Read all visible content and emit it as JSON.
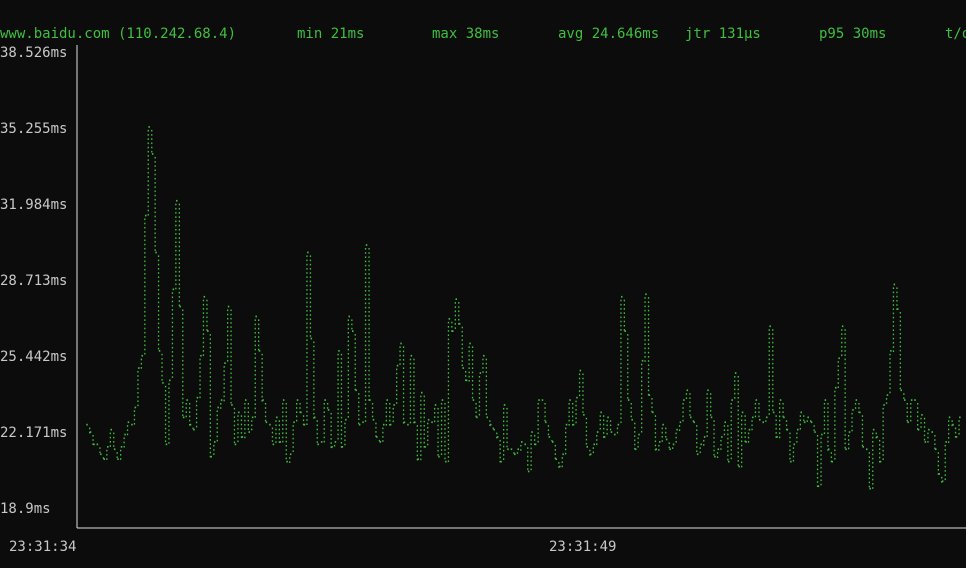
{
  "header": {
    "target": "www.baidu.com (110.242.68.4)",
    "min": "min 21ms",
    "max": "max 38ms",
    "avg": "avg 24.646ms",
    "jitter": "jtr 131µs",
    "p95": "p95 30ms",
    "extra": "t/o"
  },
  "colors": {
    "background": "#0c0c0c",
    "series": "#3fbf3f",
    "axis": "#e0e0e0",
    "label": "#c8c8c8"
  },
  "chart_data": {
    "type": "scatter",
    "title": "",
    "xlabel": "",
    "ylabel": "",
    "y_tick_labels": [
      "38.526ms",
      "35.255ms",
      "31.984ms",
      "28.713ms",
      "25.442ms",
      "22.171ms",
      "18.9ms"
    ],
    "y_ticks": [
      38.526,
      35.255,
      31.984,
      28.713,
      25.442,
      22.171,
      18.9
    ],
    "ylim": [
      18.9,
      38.526
    ],
    "x_tick_labels": [
      "23:31:34",
      "23:31:49"
    ],
    "grid": false,
    "legend": "none",
    "series": [
      {
        "values": [
          23.1,
          22.8,
          22.3,
          22.3,
          21.9,
          21.7,
          22.2,
          22.9,
          22.1,
          21.7,
          22.2,
          22.7,
          23.2,
          23.1,
          23.8,
          25.4,
          25.9,
          31.6,
          35.2,
          34.1,
          30.1,
          26.1,
          24.8,
          22.3,
          24.9,
          28.6,
          32.2,
          27.9,
          23.4,
          24.1,
          23.1,
          22.9,
          24.2,
          25.9,
          28.3,
          26.9,
          21.8,
          22.4,
          23.8,
          24.1,
          25.6,
          27.9,
          23.9,
          22.3,
          23.6,
          22.6,
          24.1,
          22.8,
          23.4,
          27.5,
          26.1,
          24.1,
          23.2,
          23.1,
          22.3,
          23.4,
          22.4,
          24.1,
          21.6,
          21.9,
          23.2,
          24.1,
          23.6,
          23.1,
          30.1,
          26.6,
          23.4,
          22.3,
          22.4,
          24.1,
          23.7,
          22.2,
          22.4,
          26.1,
          22.2,
          23.3,
          27.5,
          26.9,
          24.5,
          23.1,
          23.2,
          30.4,
          24.1,
          23.3,
          22.6,
          22.4,
          23.1,
          24.1,
          23.1,
          23.9,
          25.5,
          26.4,
          23.2,
          23.1,
          25.9,
          23.2,
          21.7,
          24.4,
          22.2,
          23.3,
          23.2,
          23.9,
          21.8,
          24.1,
          21.6,
          27.4,
          26.9,
          28.2,
          27.2,
          25.4,
          24.9,
          26.4,
          24.1,
          23.4,
          25.2,
          25.9,
          23.4,
          23.1,
          22.9,
          22.6,
          21.6,
          23.9,
          22.1,
          22.1,
          21.9,
          22.1,
          22.4,
          22.3,
          21.2,
          22.8,
          22.3,
          24.1,
          24.1,
          23.2,
          22.6,
          22.4,
          21.7,
          21.4,
          21.9,
          23.1,
          24.1,
          23.1,
          24.2,
          25.3,
          23.5,
          22.2,
          21.9,
          22.3,
          22.8,
          23.6,
          22.6,
          23.4,
          22.8,
          22.7,
          23.1,
          28.3,
          26.9,
          24.1,
          23.3,
          22.1,
          22.7,
          25.7,
          28.4,
          24.3,
          23.6,
          22.1,
          22.4,
          23.1,
          22.5,
          22.1,
          22.3,
          22.9,
          23.2,
          24.1,
          24.5,
          23.4,
          23.2,
          21.9,
          22.3,
          22.6,
          24.5,
          23.4,
          21.8,
          22.1,
          22.6,
          23.2,
          21.6,
          24.1,
          25.2,
          21.4,
          23.6,
          22.4,
          22.9,
          23.4,
          24.1,
          23.3,
          23.2,
          23.4,
          27.1,
          23.6,
          22.6,
          24.1,
          23.4,
          22.9,
          21.6,
          22.3,
          22.9,
          23.6,
          23.2,
          23.4,
          23.2,
          22.8,
          20.6,
          22.7,
          24.1,
          22.1,
          21.6,
          24.6,
          25.8,
          27.1,
          22.1,
          22.8,
          23.7,
          24.1,
          23.6,
          22.2,
          22.1,
          20.5,
          22.9,
          22.6,
          21.6,
          23.9,
          24.3,
          26.1,
          28.8,
          27.8,
          24.5,
          24.1,
          23.2,
          24.1,
          24.1,
          22.9,
          23.5,
          22.4,
          22.9,
          22.8,
          22.1,
          21.1,
          20.8,
          22.4,
          23.4,
          23.1,
          22.6,
          23.4
        ]
      }
    ]
  }
}
